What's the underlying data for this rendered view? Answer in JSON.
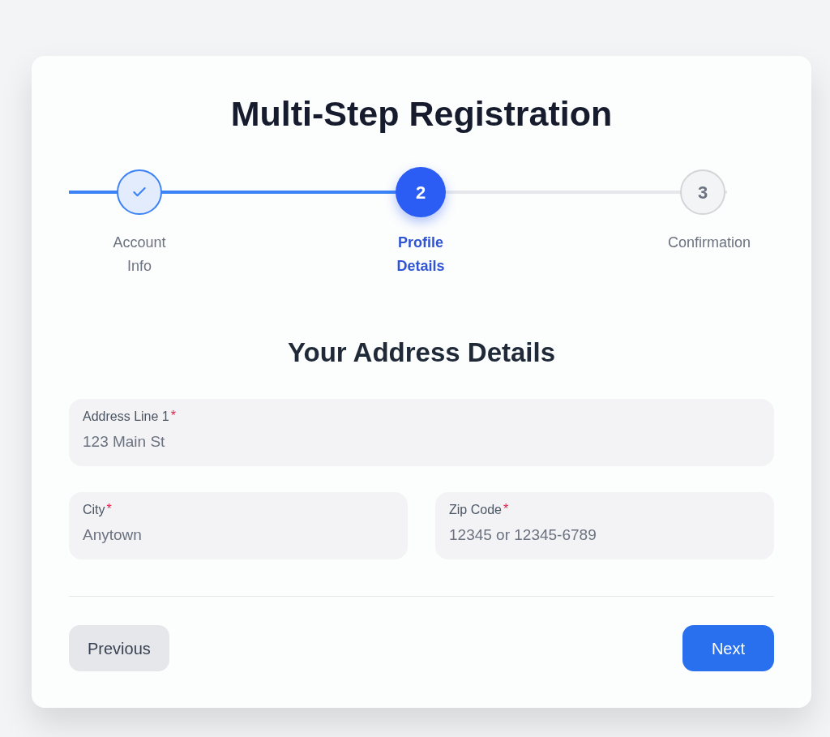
{
  "title": "Multi-Step Registration",
  "stepper": {
    "level": 0.54,
    "steps": [
      {
        "label": "Account Info",
        "completed": true,
        "selected": false
      },
      {
        "label": "Profile Details",
        "number": "2",
        "completed": false,
        "selected": true
      },
      {
        "label": "Confirmation",
        "number": "3",
        "completed": false,
        "selected": false
      }
    ]
  },
  "section_title": "Your Address Details",
  "rows": [
    [
      {
        "label": "Address Line 1",
        "required_mark": "*",
        "placeholder": "123 Main St"
      }
    ],
    [
      {
        "label": "City",
        "required_mark": "*",
        "placeholder": "Anytown"
      },
      {
        "label": "Zip Code",
        "required_mark": "*",
        "placeholder": "12345 or 12345-6789"
      }
    ]
  ],
  "buttons": [
    {
      "label": "Previous",
      "kind": "secondary"
    },
    {
      "label": "Next",
      "kind": "primary"
    }
  ]
}
